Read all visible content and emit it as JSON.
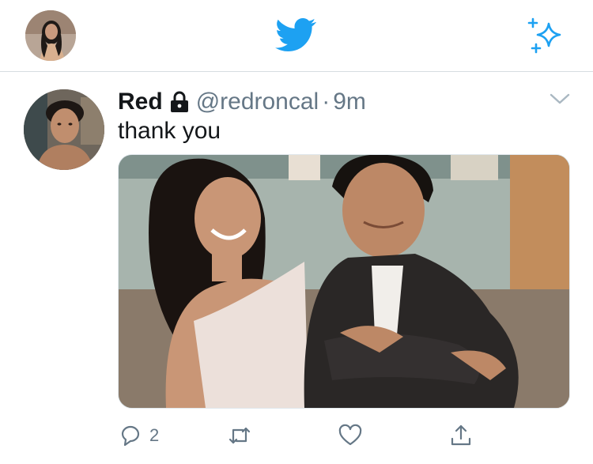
{
  "topbar": {
    "avatar_icon": "profile-avatar",
    "logo_icon": "twitter-bird-icon",
    "sparkle_icon": "sparkle-icon",
    "brand_color": "#1da1f2"
  },
  "tweet": {
    "author_name": "Red",
    "protected_icon": "lock-icon",
    "handle": "@redroncal",
    "separator": "·",
    "time": "9m",
    "text": "thank you",
    "media_description_icon": "photo",
    "actions": {
      "reply_count": "2"
    }
  }
}
